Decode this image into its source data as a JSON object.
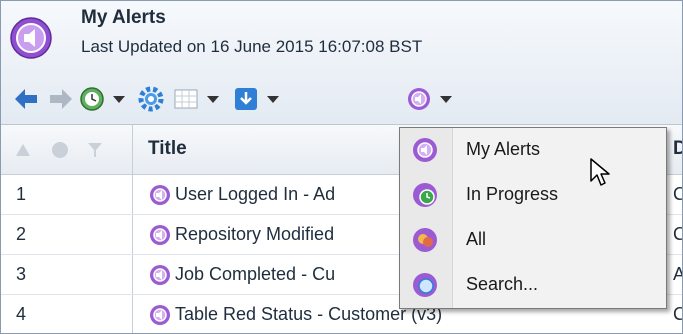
{
  "header": {
    "title": "My Alerts",
    "last_updated": "Last Updated on 16 June 2015 16:07:08 BST"
  },
  "toolbar": {
    "icons": [
      "back-arrow-icon",
      "forward-arrow-icon",
      "clock-globe-icon",
      "gear-icon",
      "grid-icon",
      "download-icon",
      "alerts-icon"
    ]
  },
  "grid": {
    "columns": {
      "title": "Title",
      "next": "D"
    },
    "rows": [
      {
        "num": "1",
        "title": "User Logged In - Ad",
        "next": "C"
      },
      {
        "num": "2",
        "title": "Repository Modified",
        "next": "C"
      },
      {
        "num": "3",
        "title": "Job Completed - Cu",
        "next": "A"
      },
      {
        "num": "4",
        "title": "Table Red Status - Customer (v3)",
        "next": "C"
      }
    ]
  },
  "menu": {
    "items": [
      {
        "label": "My Alerts",
        "icon": "alert-icon"
      },
      {
        "label": "In Progress",
        "icon": "in-progress-icon"
      },
      {
        "label": "All",
        "icon": "all-alerts-icon"
      },
      {
        "label": "Search...",
        "icon": "search-alerts-icon"
      }
    ]
  },
  "colors": {
    "accent_purple": "#9b5bd3",
    "toolbar_blue": "#2f7fd6"
  }
}
